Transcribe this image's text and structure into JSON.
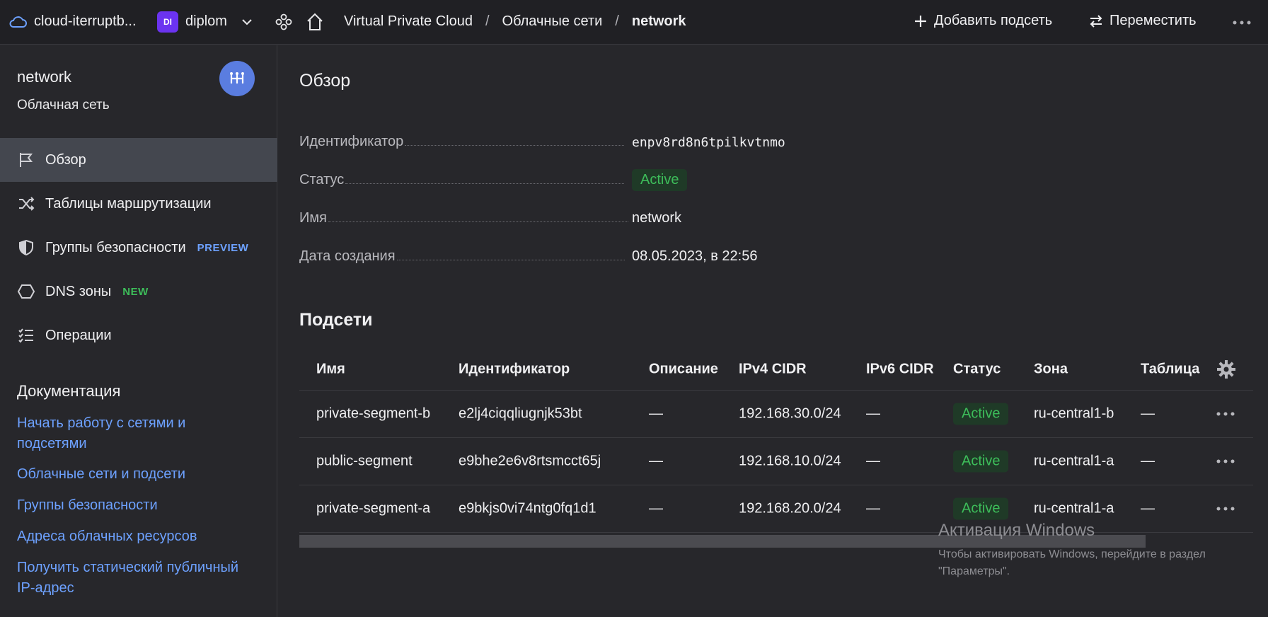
{
  "topbar": {
    "cloud_name": "cloud-iterruptb...",
    "folder_badge": "DI",
    "folder_name": "diplom",
    "breadcrumbs": [
      "Virtual Private Cloud",
      "Облачные сети",
      "network"
    ],
    "add_subnet": "Добавить подсеть",
    "move": "Переместить"
  },
  "sidebar": {
    "title": "network",
    "subtitle": "Облачная сеть",
    "nav": [
      {
        "label": "Обзор",
        "icon": "flag-icon",
        "active": true
      },
      {
        "label": "Таблицы маршрутизации",
        "icon": "shuffle-icon"
      },
      {
        "label": "Группы безопасности",
        "icon": "shield-icon",
        "tag": "PREVIEW"
      },
      {
        "label": "DNS зоны",
        "icon": "hexagon-icon",
        "tag": "NEW"
      },
      {
        "label": "Операции",
        "icon": "list-icon"
      }
    ],
    "docs_heading": "Документация",
    "docs_links": [
      "Начать работу с сетями и подсетями",
      "Облачные сети и подсети",
      "Группы безопасности",
      "Адреса облачных ресурсов",
      "Получить статический публичный IP-адрес"
    ]
  },
  "overview": {
    "heading": "Обзор",
    "fields": [
      {
        "key": "Идентификатор",
        "value": "enpv8rd8n6tpilkvtnmo"
      },
      {
        "key": "Статус",
        "value": "Active"
      },
      {
        "key": "Имя",
        "value": "network"
      },
      {
        "key": "Дата создания",
        "value": "08.05.2023, в 22:56"
      }
    ]
  },
  "subnets": {
    "heading": "Подсети",
    "columns": [
      "Имя",
      "Идентификатор",
      "Описание",
      "IPv4 CIDR",
      "IPv6 CIDR",
      "Статус",
      "Зона",
      "Таблица"
    ],
    "rows": [
      [
        "private-segment-b",
        "e2lj4ciqqliugnjk53bt",
        "—",
        "192.168.30.0/24",
        "—",
        "Active",
        "ru-central1-b",
        "—"
      ],
      [
        "public-segment",
        "e9bhe2e6v8rtsmcct65j",
        "—",
        "192.168.10.0/24",
        "—",
        "Active",
        "ru-central1-a",
        "—"
      ],
      [
        "private-segment-a",
        "e9bkjs0vi74ntg0fq1d1",
        "—",
        "192.168.20.0/24",
        "—",
        "Active",
        "ru-central1-a",
        "—"
      ]
    ]
  },
  "windows_watermark": {
    "title": "Активация Windows",
    "line1": "Чтобы активировать Windows, перейдите в раздел",
    "line2": "\"Параметры\"."
  },
  "colors": {
    "accent_link": "#6da1ff",
    "active_green": "#3dbd5a",
    "folder_badge": "#6b33f0",
    "avatar": "#5a7de0"
  }
}
